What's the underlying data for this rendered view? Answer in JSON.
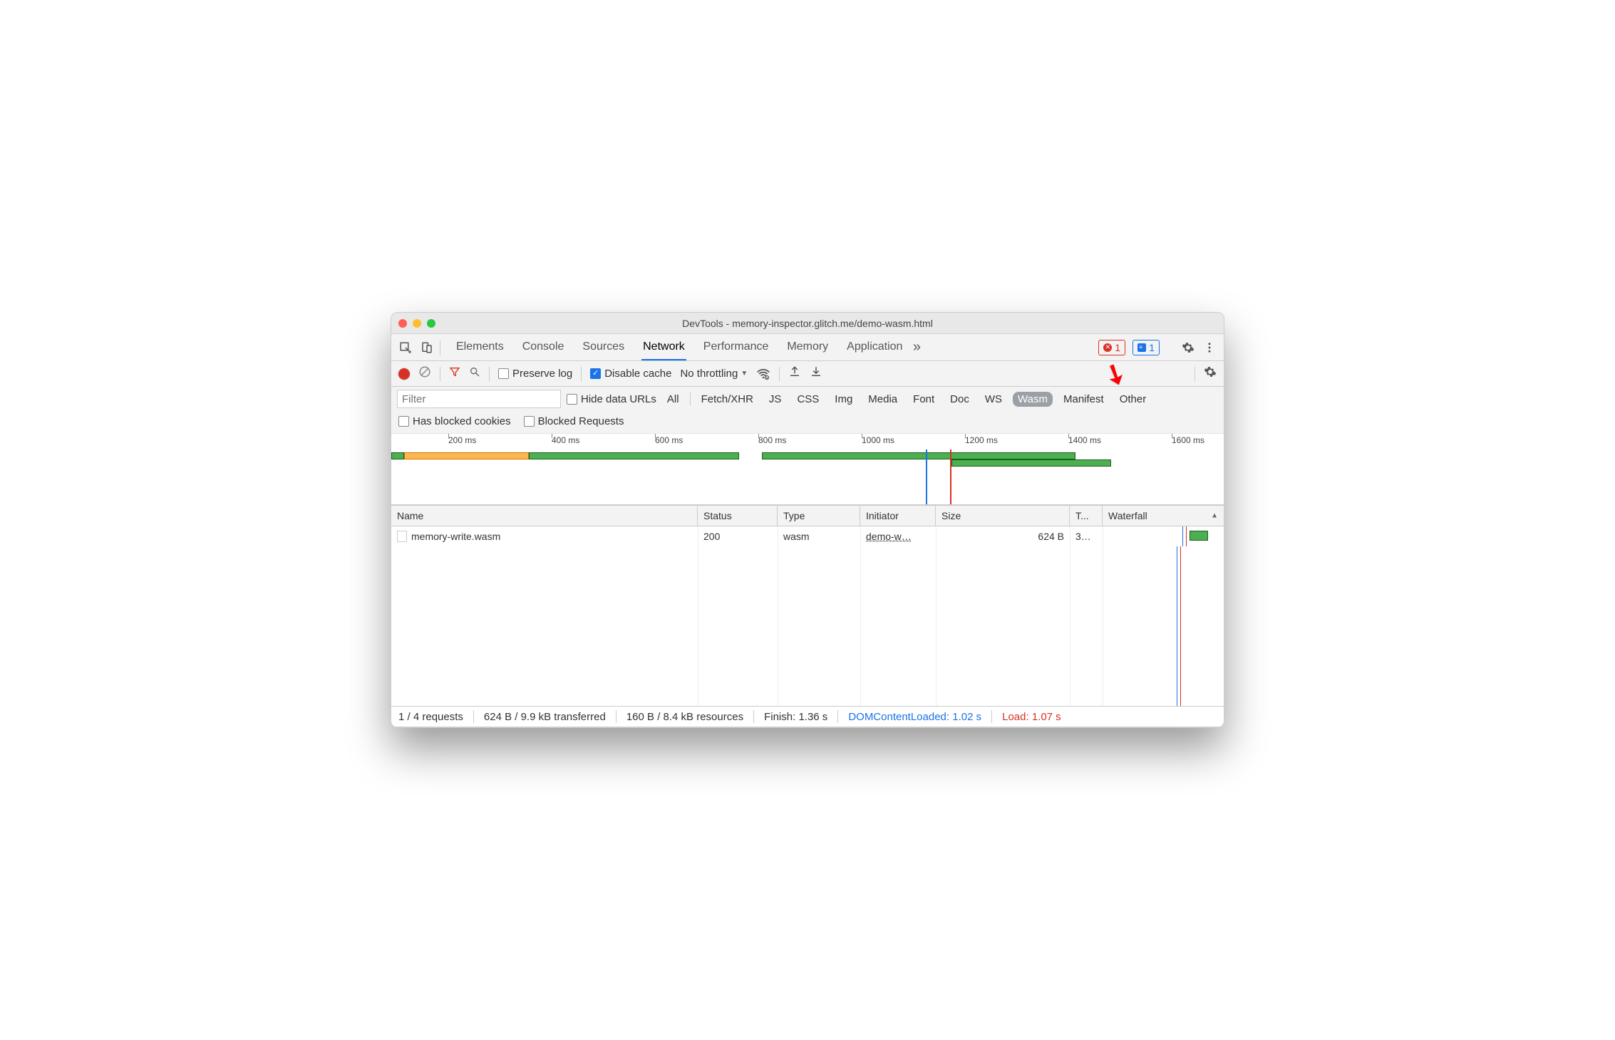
{
  "window": {
    "title": "DevTools - memory-inspector.glitch.me/demo-wasm.html"
  },
  "main_tabs": {
    "items": [
      "Elements",
      "Console",
      "Sources",
      "Network",
      "Performance",
      "Memory",
      "Application"
    ],
    "active": "Network",
    "errors_badge": "1",
    "messages_badge": "1"
  },
  "toolbar": {
    "preserve_log": "Preserve log",
    "disable_cache": "Disable cache",
    "throttling": "No throttling"
  },
  "filter": {
    "placeholder": "Filter",
    "hide_data_urls": "Hide data URLs",
    "types": [
      "All",
      "Fetch/XHR",
      "JS",
      "CSS",
      "Img",
      "Media",
      "Font",
      "Doc",
      "WS",
      "Wasm",
      "Manifest",
      "Other"
    ],
    "selected_type": "Wasm",
    "has_blocked_cookies": "Has blocked cookies",
    "blocked_requests": "Blocked Requests"
  },
  "overview": {
    "ticks": [
      "200 ms",
      "400 ms",
      "600 ms",
      "800 ms",
      "1000 ms",
      "1200 ms",
      "1400 ms",
      "1600 ms"
    ]
  },
  "table": {
    "headers": [
      "Name",
      "Status",
      "Type",
      "Initiator",
      "Size",
      "T...",
      "Waterfall"
    ],
    "rows": [
      {
        "name": "memory-write.wasm",
        "status": "200",
        "type": "wasm",
        "initiator": "demo-w…",
        "size": "624 B",
        "time": "3…"
      }
    ]
  },
  "status": {
    "requests": "1 / 4 requests",
    "transferred": "624 B / 9.9 kB transferred",
    "resources": "160 B / 8.4 kB resources",
    "finish": "Finish: 1.36 s",
    "dcl": "DOMContentLoaded: 1.02 s",
    "load": "Load: 1.07 s"
  }
}
